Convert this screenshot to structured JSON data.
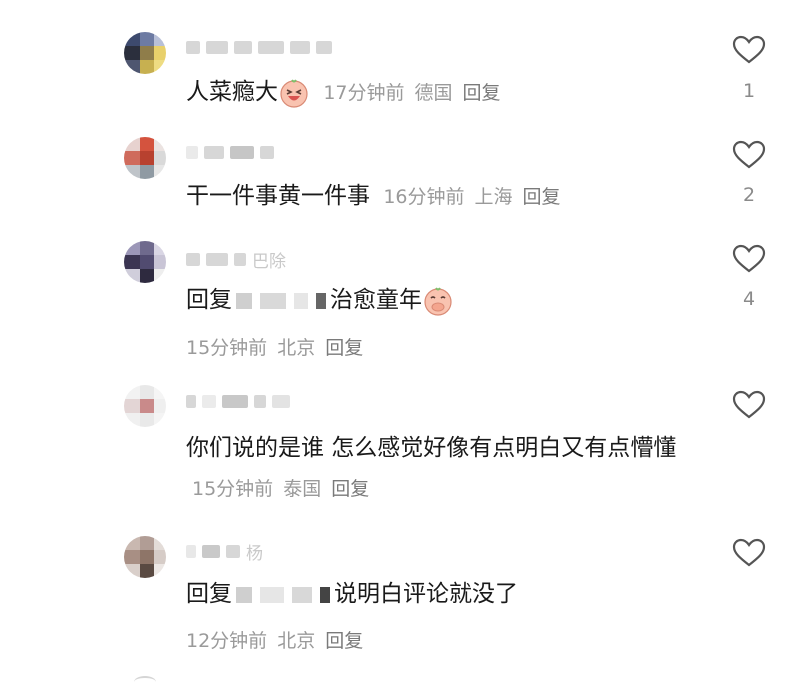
{
  "comments": [
    {
      "username": "",
      "text": "人菜瘾大",
      "time": "17分钟前",
      "location": "德国",
      "reply": "回复",
      "likes": "1"
    },
    {
      "username": "",
      "text": "干一件事黄一件事",
      "time": "16分钟前",
      "location": "上海",
      "reply": "回复",
      "likes": "2"
    },
    {
      "username": "巴除",
      "text_prefix": "回复",
      "text": "治愈童年",
      "time": "15分钟前",
      "location": "北京",
      "reply": "回复",
      "likes": "4"
    },
    {
      "username": "",
      "text": "你们说的是谁 怎么感觉好像有点明白又有点懵懂",
      "time": "15分钟前",
      "location": "泰国",
      "reply": "回复",
      "likes": ""
    },
    {
      "username": "杨",
      "text_prefix": "回复",
      "text": "说明白评论就没了",
      "time": "12分钟前",
      "location": "北京",
      "reply": "回复",
      "likes": ""
    }
  ],
  "icons": {
    "like": "heart-outline-icon",
    "emoji_laugh": "laughing-face-emoji",
    "emoji_shy": "covering-mouth-emoji"
  },
  "colors": {
    "text": "#1a1a1a",
    "meta": "#9a9a9a",
    "heart_stroke": "#555555"
  }
}
